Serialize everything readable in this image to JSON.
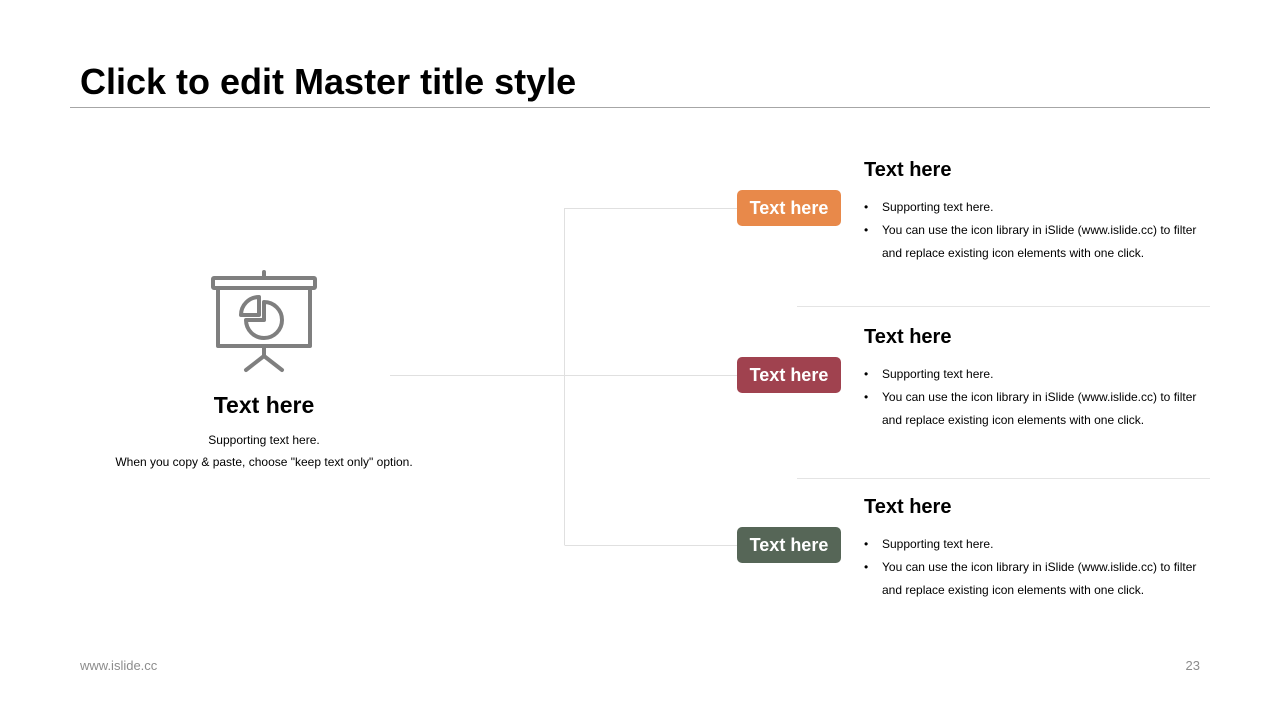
{
  "header": {
    "title": "Click to edit Master title style"
  },
  "left_panel": {
    "icon": "presentation-pie-chart-icon",
    "heading": "Text here",
    "line1": "Supporting text here.",
    "line2": "When you copy & paste, choose \"keep text only\" option."
  },
  "items": [
    {
      "pill_label": "Text here",
      "pill_color": "#E8894A",
      "heading": "Text here",
      "bullets": [
        "Supporting text here.",
        "You can use the icon library in iSlide  (www.islide.cc) to filter and replace existing icon elements with one click."
      ]
    },
    {
      "pill_label": "Text here",
      "pill_color": "#A0424F",
      "heading": "Text here",
      "bullets": [
        "Supporting text here.",
        "You can use the icon library in iSlide  (www.islide.cc) to filter and replace existing icon elements with one click."
      ]
    },
    {
      "pill_label": "Text here",
      "pill_color": "#566657",
      "heading": "Text here",
      "bullets": [
        "Supporting text here.",
        "You can use the icon library in iSlide  (www.islide.cc) to filter and replace existing icon elements with one click."
      ]
    }
  ],
  "footer": {
    "url": "www.islide.cc",
    "page_number": "23"
  },
  "colors": {
    "icon": "#7F7F7F",
    "connector": "#E0E0E0",
    "rule": "#A6A6A6",
    "footer_text": "#8C8C8C"
  }
}
